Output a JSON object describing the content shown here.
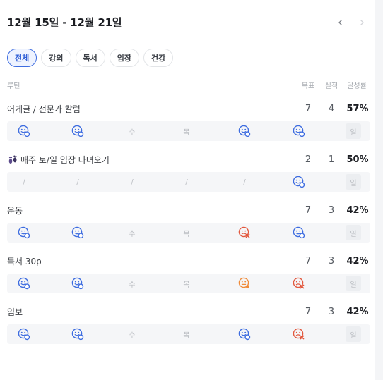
{
  "header": {
    "title": "12월 15일 - 12월 21일"
  },
  "filters": [
    "전체",
    "강의",
    "독서",
    "임장",
    "건강"
  ],
  "columns": {
    "routine": "루틴",
    "goal": "목표",
    "done": "실적",
    "rate": "달성률"
  },
  "colors": {
    "accent": "#2f5fd6",
    "success": "#3d6ce0",
    "fail": "#e2583e",
    "partial": "#f08b3a"
  },
  "routines": [
    {
      "name": "어게글 / 전문가 칼럼",
      "goal": "7",
      "done": "4",
      "rate": "57%",
      "days": [
        {
          "status": "done"
        },
        {
          "status": "done"
        },
        {
          "status": "label",
          "text": "수"
        },
        {
          "status": "label",
          "text": "목"
        },
        {
          "status": "done"
        },
        {
          "status": "done"
        },
        {
          "status": "label",
          "text": "일",
          "box": true
        }
      ]
    },
    {
      "name": "매주 토/일 임장 다녀오기",
      "icon": "footprints-icon",
      "goal": "2",
      "done": "1",
      "rate": "50%",
      "days": [
        {
          "status": "label",
          "text": "/"
        },
        {
          "status": "label",
          "text": "/"
        },
        {
          "status": "label",
          "text": "/"
        },
        {
          "status": "label",
          "text": "/"
        },
        {
          "status": "label",
          "text": "/"
        },
        {
          "status": "done"
        },
        {
          "status": "label",
          "text": "일",
          "box": true
        }
      ]
    },
    {
      "name": "운동",
      "goal": "7",
      "done": "3",
      "rate": "42%",
      "days": [
        {
          "status": "done"
        },
        {
          "status": "done"
        },
        {
          "status": "label",
          "text": "수"
        },
        {
          "status": "label",
          "text": "목"
        },
        {
          "status": "fail"
        },
        {
          "status": "done"
        },
        {
          "status": "label",
          "text": "일",
          "box": true
        }
      ]
    },
    {
      "name": "독서 30p",
      "goal": "7",
      "done": "3",
      "rate": "42%",
      "days": [
        {
          "status": "done"
        },
        {
          "status": "done"
        },
        {
          "status": "label",
          "text": "수"
        },
        {
          "status": "label",
          "text": "목"
        },
        {
          "status": "partial"
        },
        {
          "status": "fail"
        },
        {
          "status": "label",
          "text": "일",
          "box": true
        }
      ]
    },
    {
      "name": "임보",
      "goal": "7",
      "done": "3",
      "rate": "42%",
      "days": [
        {
          "status": "done"
        },
        {
          "status": "done"
        },
        {
          "status": "label",
          "text": "수"
        },
        {
          "status": "label",
          "text": "목"
        },
        {
          "status": "done"
        },
        {
          "status": "fail"
        },
        {
          "status": "label",
          "text": "일",
          "box": true
        }
      ]
    }
  ]
}
